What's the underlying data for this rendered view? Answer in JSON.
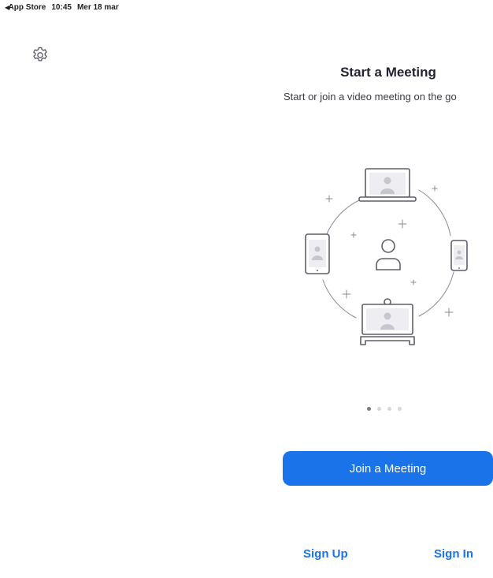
{
  "status_bar": {
    "back_glyph": "◀",
    "back_label": "App Store",
    "time": "10:45",
    "date": "Mer 18 mar"
  },
  "settings": {
    "icon": "gear-icon"
  },
  "carousel": {
    "title": "Start a Meeting",
    "subtitle": "Start or join a video meeting on the go",
    "illustration": "meeting-devices-illustration",
    "page_count": 4,
    "active_page": 1
  },
  "actions": {
    "join_label": "Join a Meeting",
    "signup_label": "Sign Up",
    "signin_label": "Sign In"
  },
  "colors": {
    "accent": "#1a73e8",
    "text": "#232333"
  }
}
